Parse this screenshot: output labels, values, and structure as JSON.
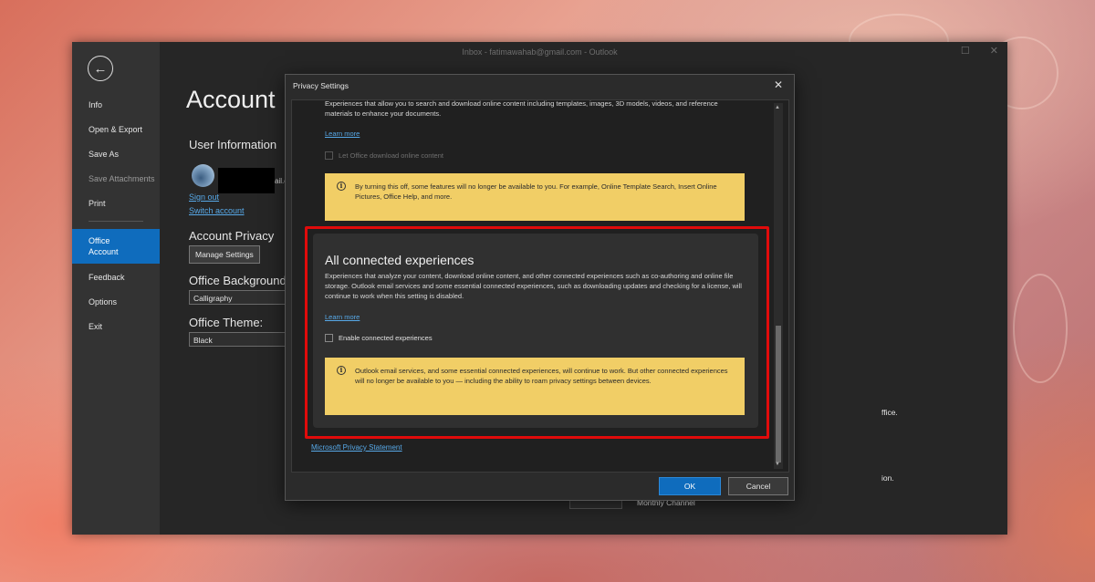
{
  "window": {
    "title": "Inbox - fatimawahab@gmail.com  -  Outlook",
    "controls": [
      "☐",
      "✕"
    ]
  },
  "nav": {
    "back_icon": "←",
    "items": {
      "info": "Info",
      "open_export": "Open & Export",
      "save_as": "Save As",
      "save_attachments": "Save Attachments",
      "print": "Print",
      "office_account_line1": "Office",
      "office_account_line2": "Account",
      "feedback": "Feedback",
      "options": "Options",
      "exit": "Exit"
    }
  },
  "account": {
    "page_title": "Account",
    "user_info_heading": "User Information",
    "email_tail": "ail.c",
    "sign_out": "Sign out",
    "switch_account": "Switch account",
    "privacy_heading": "Account Privacy",
    "manage_settings": "Manage Settings",
    "background_heading": "Office Background",
    "background_value": "Calligraphy",
    "theme_heading": "Office Theme:",
    "theme_value": "Black",
    "frag_office": "ffice.",
    "frag_ion": "ion.",
    "monthly_channel": "Monthly Channel"
  },
  "dialog": {
    "title": "Privacy Settings",
    "close_icon": "✕",
    "top_description": "Experiences that allow you to search and download online content including templates, images, 3D models, videos, and reference materials to enhance your documents.",
    "top_learn_more": "Learn more",
    "top_checkbox_label": "Let Office download online content",
    "top_warning": "By turning this off, some features will no longer be available to you. For example, Online Template Search, Insert Online Pictures, Office Help, and more.",
    "card_title": "All connected experiences",
    "card_description": "Experiences that analyze your content, download online content, and other connected experiences such as co-authoring and online file storage. Outlook email services and some essential connected experiences, such as downloading updates and checking for a license, will continue to work when this setting is disabled.",
    "card_learn_more": "Learn more",
    "card_checkbox_label": "Enable connected experiences",
    "card_warning": "Outlook email services, and some essential connected experiences, will continue to work. But other connected experiences will no longer be available to you — including the ability to roam privacy settings between devices.",
    "privacy_statement": "Microsoft Privacy Statement",
    "ok": "OK",
    "cancel": "Cancel",
    "info_icon": "i"
  },
  "colors": {
    "accent": "#0f6cbd",
    "highlight": "#e00b0b",
    "warning_bg": "#f1ce66"
  }
}
